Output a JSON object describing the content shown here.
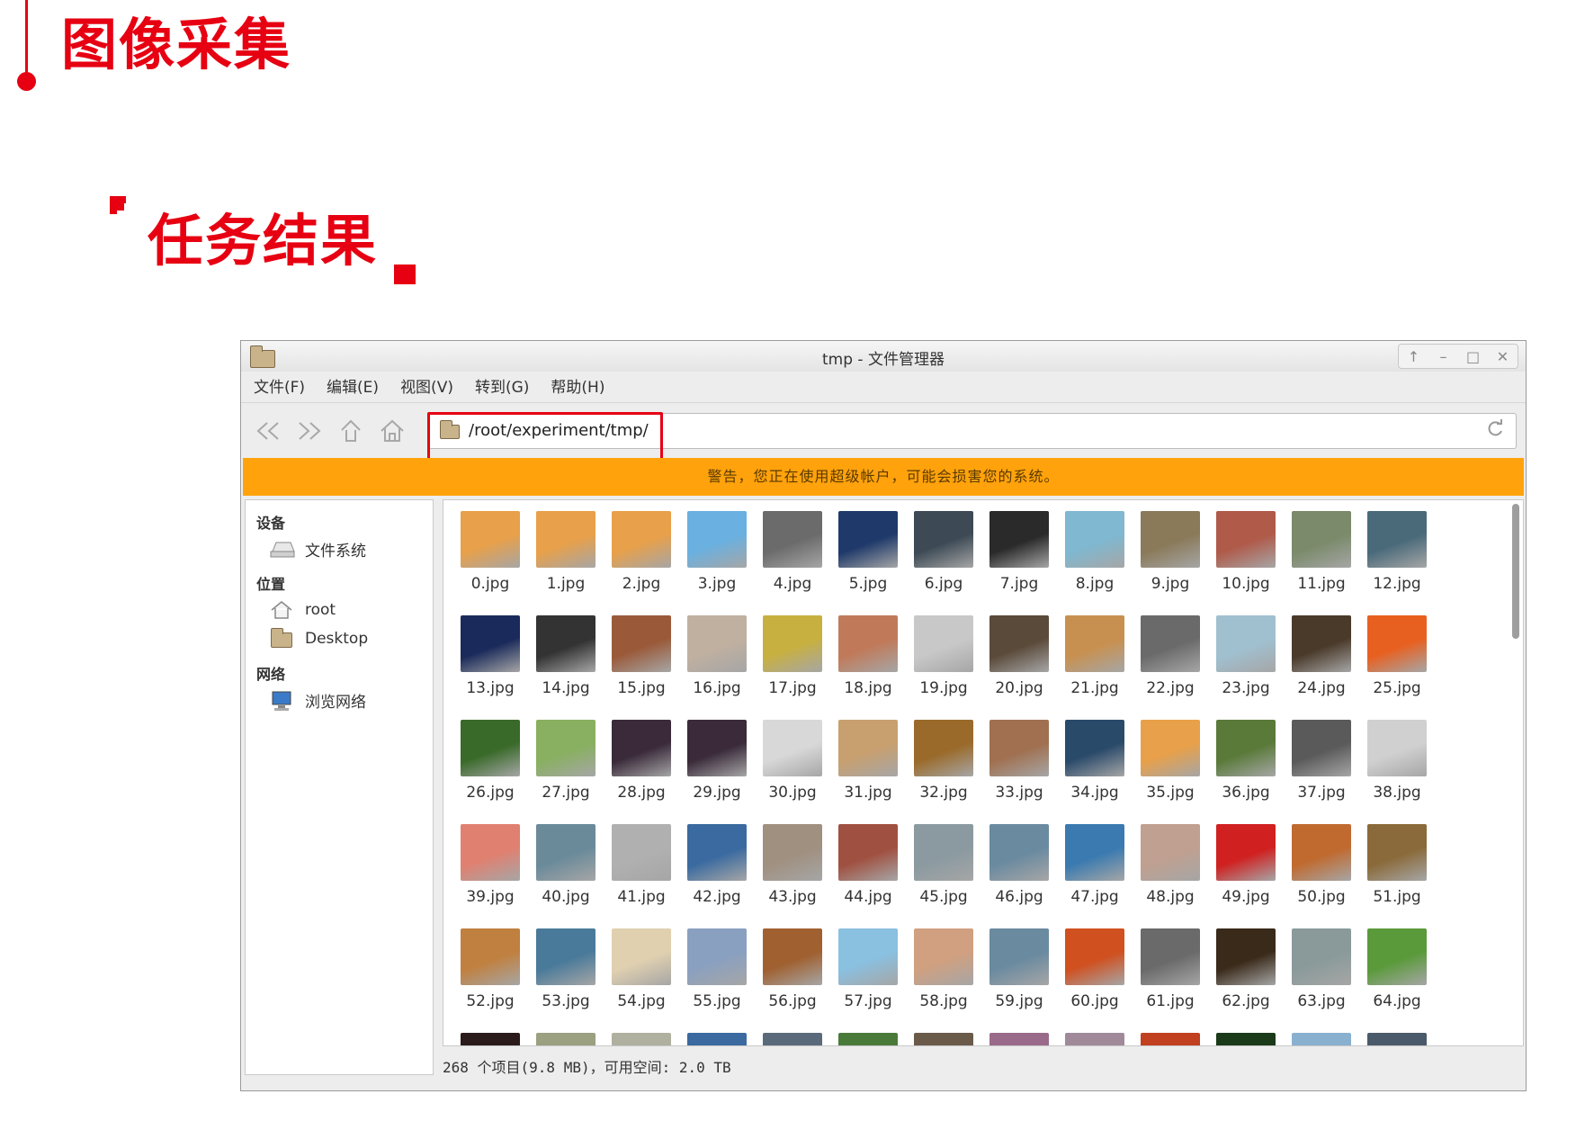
{
  "slide": {
    "title": "图像采集",
    "subtitle": "任务结果"
  },
  "window": {
    "title": "tmp - 文件管理器",
    "controls": [
      "↑",
      "–",
      "□",
      "✕"
    ],
    "menu": [
      "文件(F)",
      "编辑(E)",
      "视图(V)",
      "转到(G)",
      "帮助(H)"
    ],
    "toolbar": {
      "back": "back-icon",
      "forward": "forward-icon",
      "up": "up-icon",
      "home": "home-icon"
    },
    "address": "/root/experiment/tmp/",
    "warning": "警告，您正在使用超级帐户，可能会损害您的系统。",
    "sidebar": {
      "devices_header": "设备",
      "filesystem": "文件系统",
      "places_header": "位置",
      "root": "root",
      "desktop": "Desktop",
      "network_header": "网络",
      "browse_network": "浏览网络"
    },
    "files": [
      "0.jpg",
      "1.jpg",
      "2.jpg",
      "3.jpg",
      "4.jpg",
      "5.jpg",
      "6.jpg",
      "7.jpg",
      "8.jpg",
      "9.jpg",
      "10.jpg",
      "11.jpg",
      "12.jpg",
      "13.jpg",
      "14.jpg",
      "15.jpg",
      "16.jpg",
      "17.jpg",
      "18.jpg",
      "19.jpg",
      "20.jpg",
      "21.jpg",
      "22.jpg",
      "23.jpg",
      "24.jpg",
      "25.jpg",
      "26.jpg",
      "27.jpg",
      "28.jpg",
      "29.jpg",
      "30.jpg",
      "31.jpg",
      "32.jpg",
      "33.jpg",
      "34.jpg",
      "35.jpg",
      "36.jpg",
      "37.jpg",
      "38.jpg",
      "39.jpg",
      "40.jpg",
      "41.jpg",
      "42.jpg",
      "43.jpg",
      "44.jpg",
      "45.jpg",
      "46.jpg",
      "47.jpg",
      "48.jpg",
      "49.jpg",
      "50.jpg",
      "51.jpg",
      "52.jpg",
      "53.jpg",
      "54.jpg",
      "55.jpg",
      "56.jpg",
      "57.jpg",
      "58.jpg",
      "59.jpg",
      "60.jpg",
      "61.jpg",
      "62.jpg",
      "63.jpg",
      "64.jpg",
      "",
      "",
      "",
      "",
      "",
      "",
      "",
      "",
      "",
      "",
      "",
      "",
      ""
    ],
    "thumb_colors": [
      "#e8a04a",
      "#e8a04a",
      "#e8a04a",
      "#6ab0e0",
      "#6b6b6b",
      "#1f3a6a",
      "#3d4a55",
      "#2a2a2a",
      "#7fb8d0",
      "#8a7a5a",
      "#b05a4a",
      "#7a8a6a",
      "#4a6a7a",
      "#1a2a5a",
      "#333333",
      "#9a5a3a",
      "#c0b0a0",
      "#c8b040",
      "#c07a5a",
      "#c8c8c8",
      "#5a4a3a",
      "#c89050",
      "#6a6a6a",
      "#a0c0d0",
      "#4a3a2a",
      "#e86020",
      "#3a6a2a",
      "#88b060",
      "#3a2a3a",
      "#3a2a3a",
      "#d8d8d8",
      "#c8a070",
      "#9a6a2a",
      "#a07050",
      "#2a4a6a",
      "#e8a04a",
      "#5a7a3a",
      "#5a5a5a",
      "#d0d0d0",
      "#e08070",
      "#6a8a9a",
      "#b0b0b0",
      "#3a6aa0",
      "#a09080",
      "#a05040",
      "#8a9aa0",
      "#6a8aa0",
      "#3a7ab0",
      "#c0a090",
      "#d02020",
      "#c06a30",
      "#8a6a3a",
      "#c08040",
      "#4a7a9a",
      "#e0d0b0",
      "#8aa0c0",
      "#a06030",
      "#8ac0e0",
      "#d0a080",
      "#6a8aa0",
      "#d05020",
      "#6a6a6a",
      "#3a2a1a",
      "#8a9a9a",
      "#5a9a3a",
      "#2a1a1a",
      "#9aa080",
      "#b0b0a0",
      "#3a6aa0",
      "#5a6a7a",
      "#4a7a3a",
      "#6a5a4a",
      "#9a6a8a",
      "#a08a9a",
      "#c04020",
      "#1a3a1a",
      "#8ab0d0",
      "#4a5a6a"
    ],
    "status": "268 个项目(9.8 MB)，可用空间: 2.0 TB"
  }
}
